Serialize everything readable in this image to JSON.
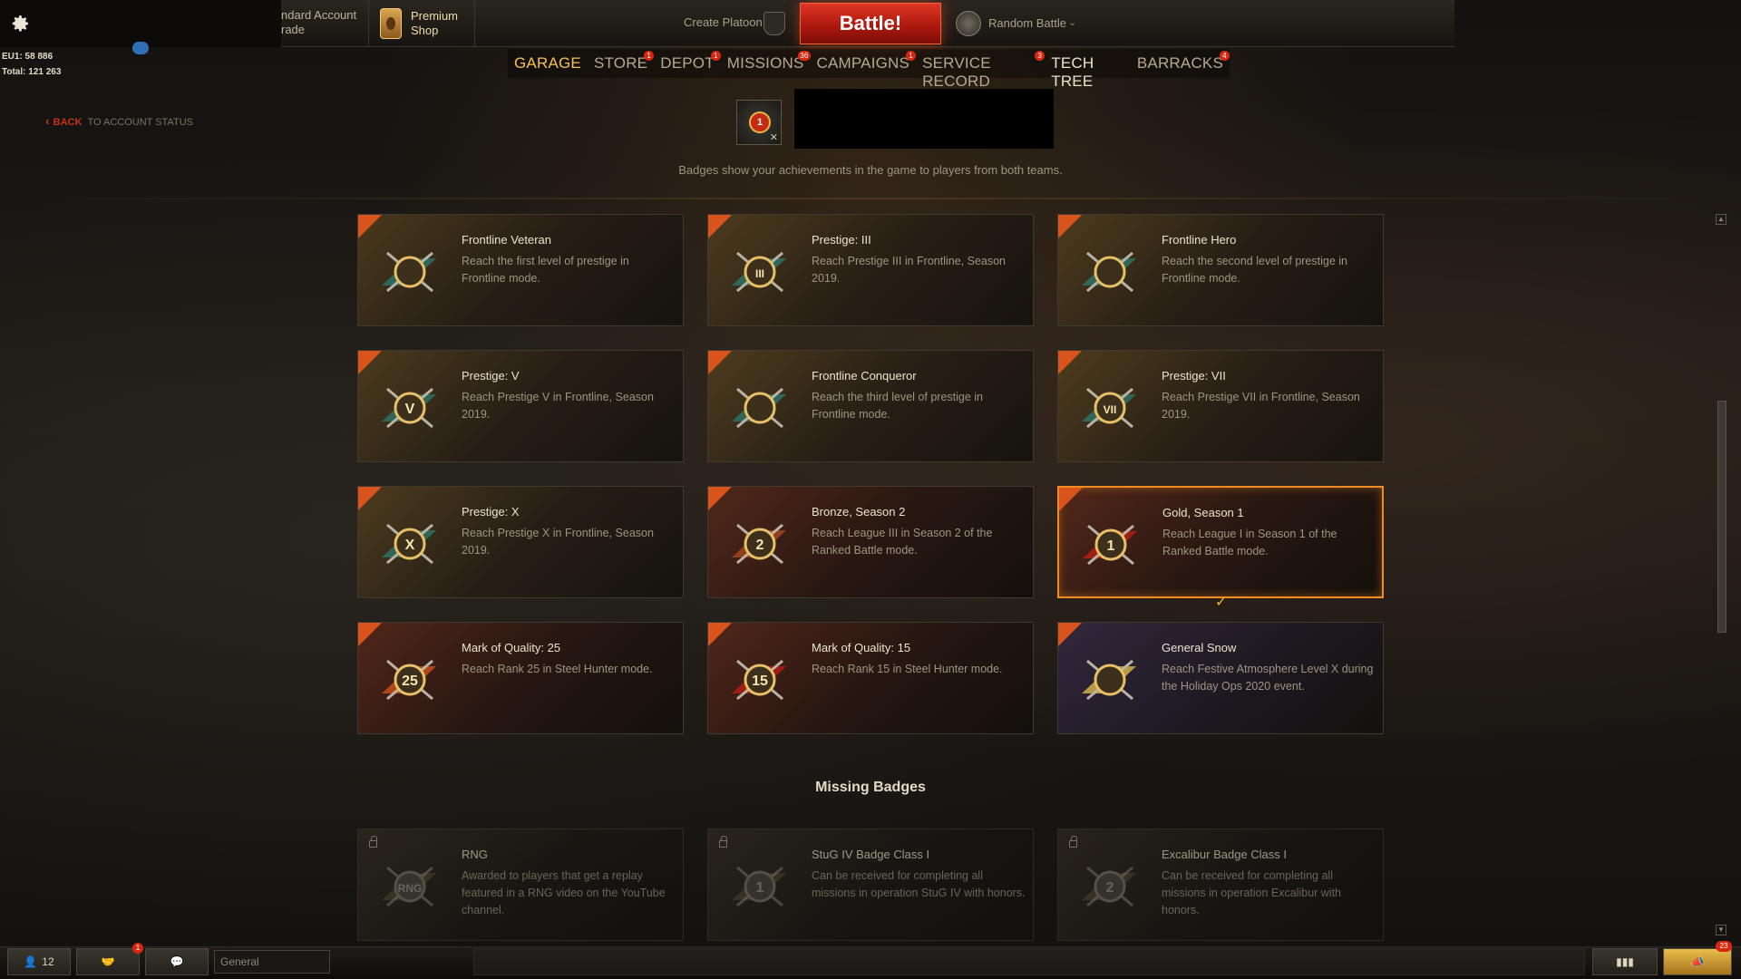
{
  "topbar": {
    "account_line1": "ndard Account",
    "account_line2": "rade",
    "premium_line1": "Premium",
    "premium_line2": "Shop",
    "create_platoon": "Create Platoon",
    "battle": "Battle!",
    "battle_mode": "Random Battle",
    "caret": "⌄"
  },
  "credits": {
    "line1": "EU1: 58 886",
    "line2": "Total: 121 263"
  },
  "nav": {
    "items": [
      {
        "label": "GARAGE",
        "badge": ""
      },
      {
        "label": "STORE",
        "badge": "1"
      },
      {
        "label": "DEPOT",
        "badge": "1"
      },
      {
        "label": "MISSIONS",
        "badge": "36"
      },
      {
        "label": "CAMPAIGNS",
        "badge": "1"
      },
      {
        "label": "SERVICE RECORD",
        "badge": "3"
      },
      {
        "label": "TECH TREE",
        "badge": ""
      },
      {
        "label": "BARRACKS",
        "badge": "4"
      }
    ],
    "active_index": 0,
    "highlight_index": 6
  },
  "header": {
    "back_label": "BACK",
    "back_target": "TO ACCOUNT STATUS",
    "selected_badge_rank": "1",
    "remove_glyph": "✕",
    "subtitle": "Badges show your achievements in the game to players from both teams."
  },
  "badges": [
    {
      "title": "Frontline Veteran",
      "desc": "Reach the first level of prestige in Frontline mode.",
      "style": "gold",
      "icon": "frontline-veteran-icon",
      "color": "#2d7a6e"
    },
    {
      "title": "Prestige: III",
      "desc": "Reach Prestige III in Frontline, Season 2019.",
      "style": "gold",
      "icon": "prestige-iii-icon",
      "color": "#2d7a6e",
      "mark": "III"
    },
    {
      "title": "Frontline Hero",
      "desc": "Reach the second level of prestige in Frontline mode.",
      "style": "gold",
      "icon": "frontline-hero-icon",
      "color": "#2d7a6e"
    },
    {
      "title": "Prestige: V",
      "desc": "Reach Prestige V in Frontline, Season 2019.",
      "style": "gold",
      "icon": "prestige-v-icon",
      "color": "#2d7a6e",
      "mark": "V"
    },
    {
      "title": "Frontline Conqueror",
      "desc": "Reach the third level of prestige in Frontline mode.",
      "style": "gold",
      "icon": "frontline-conqueror-icon",
      "color": "#2d7a6e"
    },
    {
      "title": "Prestige: VII",
      "desc": "Reach Prestige VII in Frontline, Season 2019.",
      "style": "gold",
      "icon": "prestige-vii-icon",
      "color": "#2d7a6e",
      "mark": "VII"
    },
    {
      "title": "Prestige: X",
      "desc": "Reach Prestige X in Frontline, Season 2019.",
      "style": "gold",
      "icon": "prestige-x-icon",
      "color": "#2d7a6e",
      "mark": "X"
    },
    {
      "title": "Bronze, Season 2",
      "desc": "Reach League III in Season 2 of the Ranked Battle mode.",
      "style": "red",
      "icon": "ranked-bronze-icon",
      "color": "#b04a1f",
      "mark": "2"
    },
    {
      "title": "Gold, Season 1",
      "desc": "Reach League I in Season 1 of the Ranked Battle mode.",
      "style": "red",
      "icon": "ranked-gold-icon",
      "color": "#c21d12",
      "mark": "1",
      "selected": true
    },
    {
      "title": "Mark of Quality: 25",
      "desc": "Reach Rank 25 in Steel Hunter mode.",
      "style": "red",
      "icon": "steel-hunter-25-icon",
      "color": "#d8541c",
      "mark": "25"
    },
    {
      "title": "Mark of Quality: 15",
      "desc": "Reach Rank 15 in Steel Hunter mode.",
      "style": "red",
      "icon": "steel-hunter-15-icon",
      "color": "#c21d12",
      "mark": "15"
    },
    {
      "title": "General Snow",
      "desc": "Reach Festive Atmosphere Level X during the Holiday Ops 2020 event.",
      "style": "purple",
      "icon": "snowflake-icon",
      "color": "#e8c24a"
    }
  ],
  "selected_check": "✓",
  "missing_title": "Missing Badges",
  "missing": [
    {
      "title": "RNG",
      "desc": "Awarded to players that get a replay featured in a RNG video on the YouTube channel.",
      "icon": "rng-icon",
      "mark": "RNG"
    },
    {
      "title": "StuG IV Badge Class I",
      "desc": "Can be received for completing all missions in operation StuG IV with honors.",
      "icon": "stug-badge-icon",
      "mark": "1"
    },
    {
      "title": "Excalibur Badge Class I",
      "desc": "Can be received for completing all missions in operation Excalibur with honors.",
      "icon": "excalibur-badge-icon",
      "mark": "2"
    }
  ],
  "bottombar": {
    "players_online": "12",
    "friends_badge": "1",
    "chat_channel": "General",
    "notifications_badge": "23"
  }
}
